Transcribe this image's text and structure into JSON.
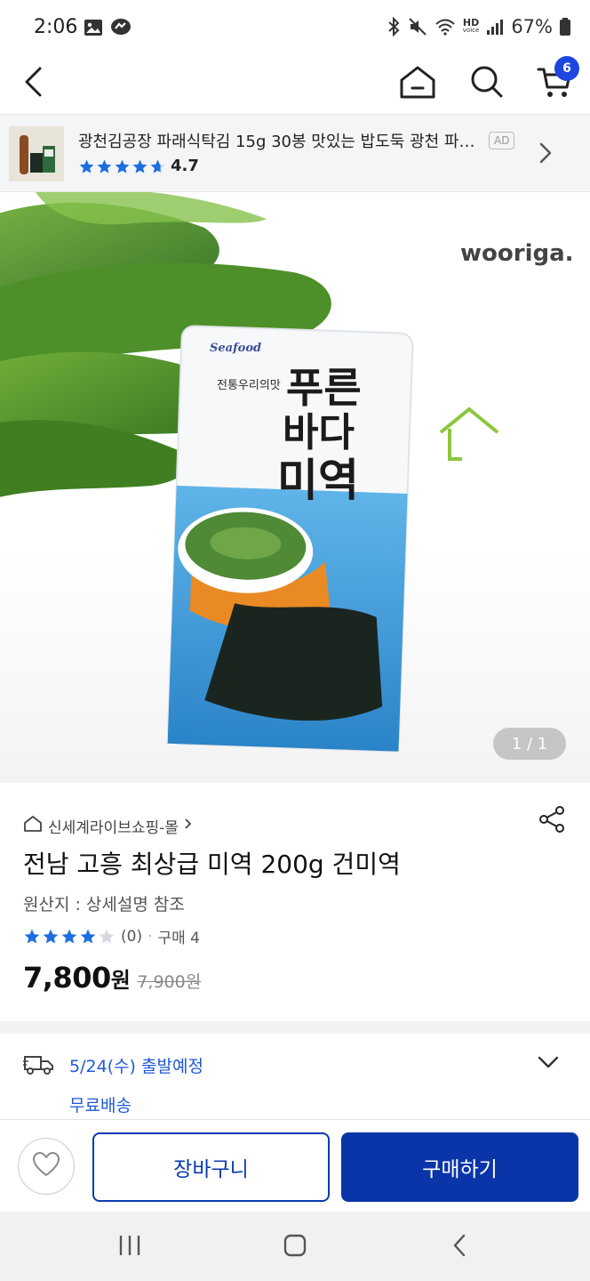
{
  "status_bar": {
    "time": "2:06",
    "battery": "67%",
    "left_icons": [
      "image-icon",
      "messenger-icon"
    ],
    "right_icons": [
      "bluetooth-icon",
      "mute-icon",
      "wifi-icon",
      "hd-voice-icon",
      "signal-icon",
      "battery-icon"
    ],
    "hd_label": "HD",
    "voice_label": "voice"
  },
  "header": {
    "back_icon": "chevron-left-icon",
    "home_icon": "home-icon",
    "search_icon": "search-icon",
    "cart_icon": "cart-icon",
    "cart_count": "6",
    "accent": "#1d46e0"
  },
  "ad": {
    "title": "광천김공장 파래식탁김 15g 30봉 맛있는 밥도둑 광천 파래김",
    "tag": "AD",
    "rating": "4.7",
    "stars": 4.7
  },
  "product_image": {
    "brand_logo": "wooriga.",
    "pack_seafood": "Seafood",
    "pack_title_1": "푸른",
    "pack_title_2": "바다",
    "pack_title_3": "미역",
    "pack_sub": "전통우리의맛",
    "counter": "1 / 1"
  },
  "product": {
    "seller": "신세계라이브쇼핑-몰",
    "title": "전남 고흥 최상급 미역 200g 건미역",
    "origin": "원산지 : 상세설명 참조",
    "stars": 4,
    "review_count": "(0)",
    "separator": "·",
    "purchase_count": "구매 4",
    "price": "7,800",
    "price_unit": "원",
    "original_price": "7,900원"
  },
  "shipping": {
    "date": "5/24(수) 출발예정",
    "free": "무료배송",
    "color": "#1f5ad6"
  },
  "actions": {
    "cart_label": "장바구니",
    "buy_label": "구매하기",
    "buy_color": "#0a35a8"
  },
  "nav": {
    "recents_icon": "recents-icon",
    "home_icon": "nav-home-icon",
    "back_icon": "nav-back-icon"
  }
}
